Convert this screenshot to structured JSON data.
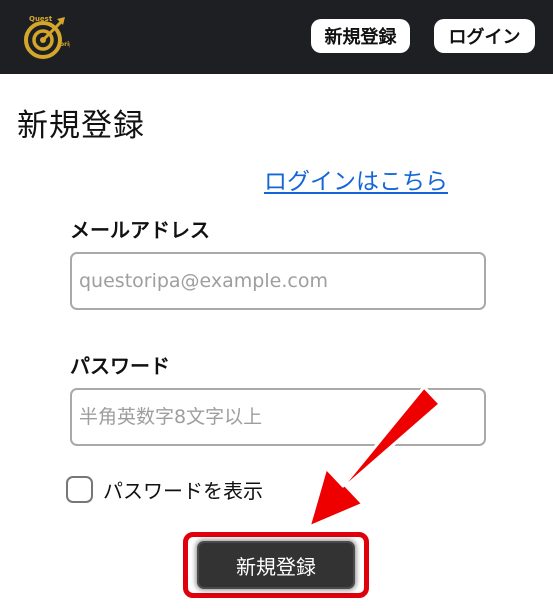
{
  "header": {
    "logo_text": "Quest oripa",
    "signup_label": "新規登録",
    "login_label": "ログイン",
    "logo_icon": "target-with-arrow-icon"
  },
  "page": {
    "title": "新規登録",
    "login_link": "ログインはこちら"
  },
  "form": {
    "email_label": "メールアドレス",
    "email_placeholder": "questoripa@example.com",
    "email_value": "",
    "password_label": "パスワード",
    "password_placeholder": "半角英数字8文字以上",
    "password_value": "",
    "show_password_label": "パスワードを表示",
    "show_password_checked": false,
    "submit_label": "新規登録"
  },
  "annotation": {
    "arrow_icon": "red-arrow-icon",
    "highlight_color": "#e0000c"
  },
  "colors": {
    "header_bg": "#1e1f23",
    "logo_gold": "#d4a72c",
    "link": "#1466d8",
    "submit_bg": "#333333"
  }
}
